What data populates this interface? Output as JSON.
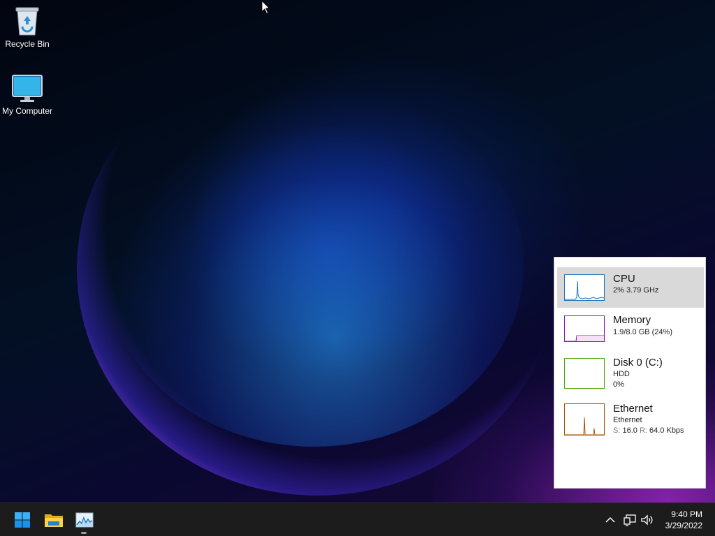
{
  "desktop": {
    "icons": [
      {
        "label": "Recycle Bin",
        "icon": "recycle-bin-icon"
      },
      {
        "label": "My Computer",
        "icon": "monitor-icon"
      }
    ]
  },
  "task_manager": {
    "items": [
      {
        "title": "CPU",
        "line1": "2% 3.79 GHz",
        "graph_color": "#1b75bb",
        "selected": true
      },
      {
        "title": "Memory",
        "line1": "1.9/8.0 GB (24%)",
        "graph_color": "#8b12ae",
        "selected": false
      },
      {
        "title": "Disk 0 (C:)",
        "line1": "HDD",
        "line2": "0%",
        "graph_color": "#4da60c",
        "selected": false
      },
      {
        "title": "Ethernet",
        "line1": "Ethernet",
        "send_label": "S:",
        "send_value": "16.0",
        "recv_label": "R:",
        "recv_value": "64.0 Kbps",
        "graph_color": "#a74f01",
        "selected": false
      }
    ]
  },
  "taskbar": {
    "start_icon": "windows-start-icon",
    "pinned": [
      "file-explorer-icon",
      "task-manager-icon"
    ],
    "tray": [
      "chevron-up-icon",
      "network-icon",
      "volume-icon"
    ],
    "clock": {
      "time": "9:40 PM",
      "date": "3/29/2022"
    }
  }
}
